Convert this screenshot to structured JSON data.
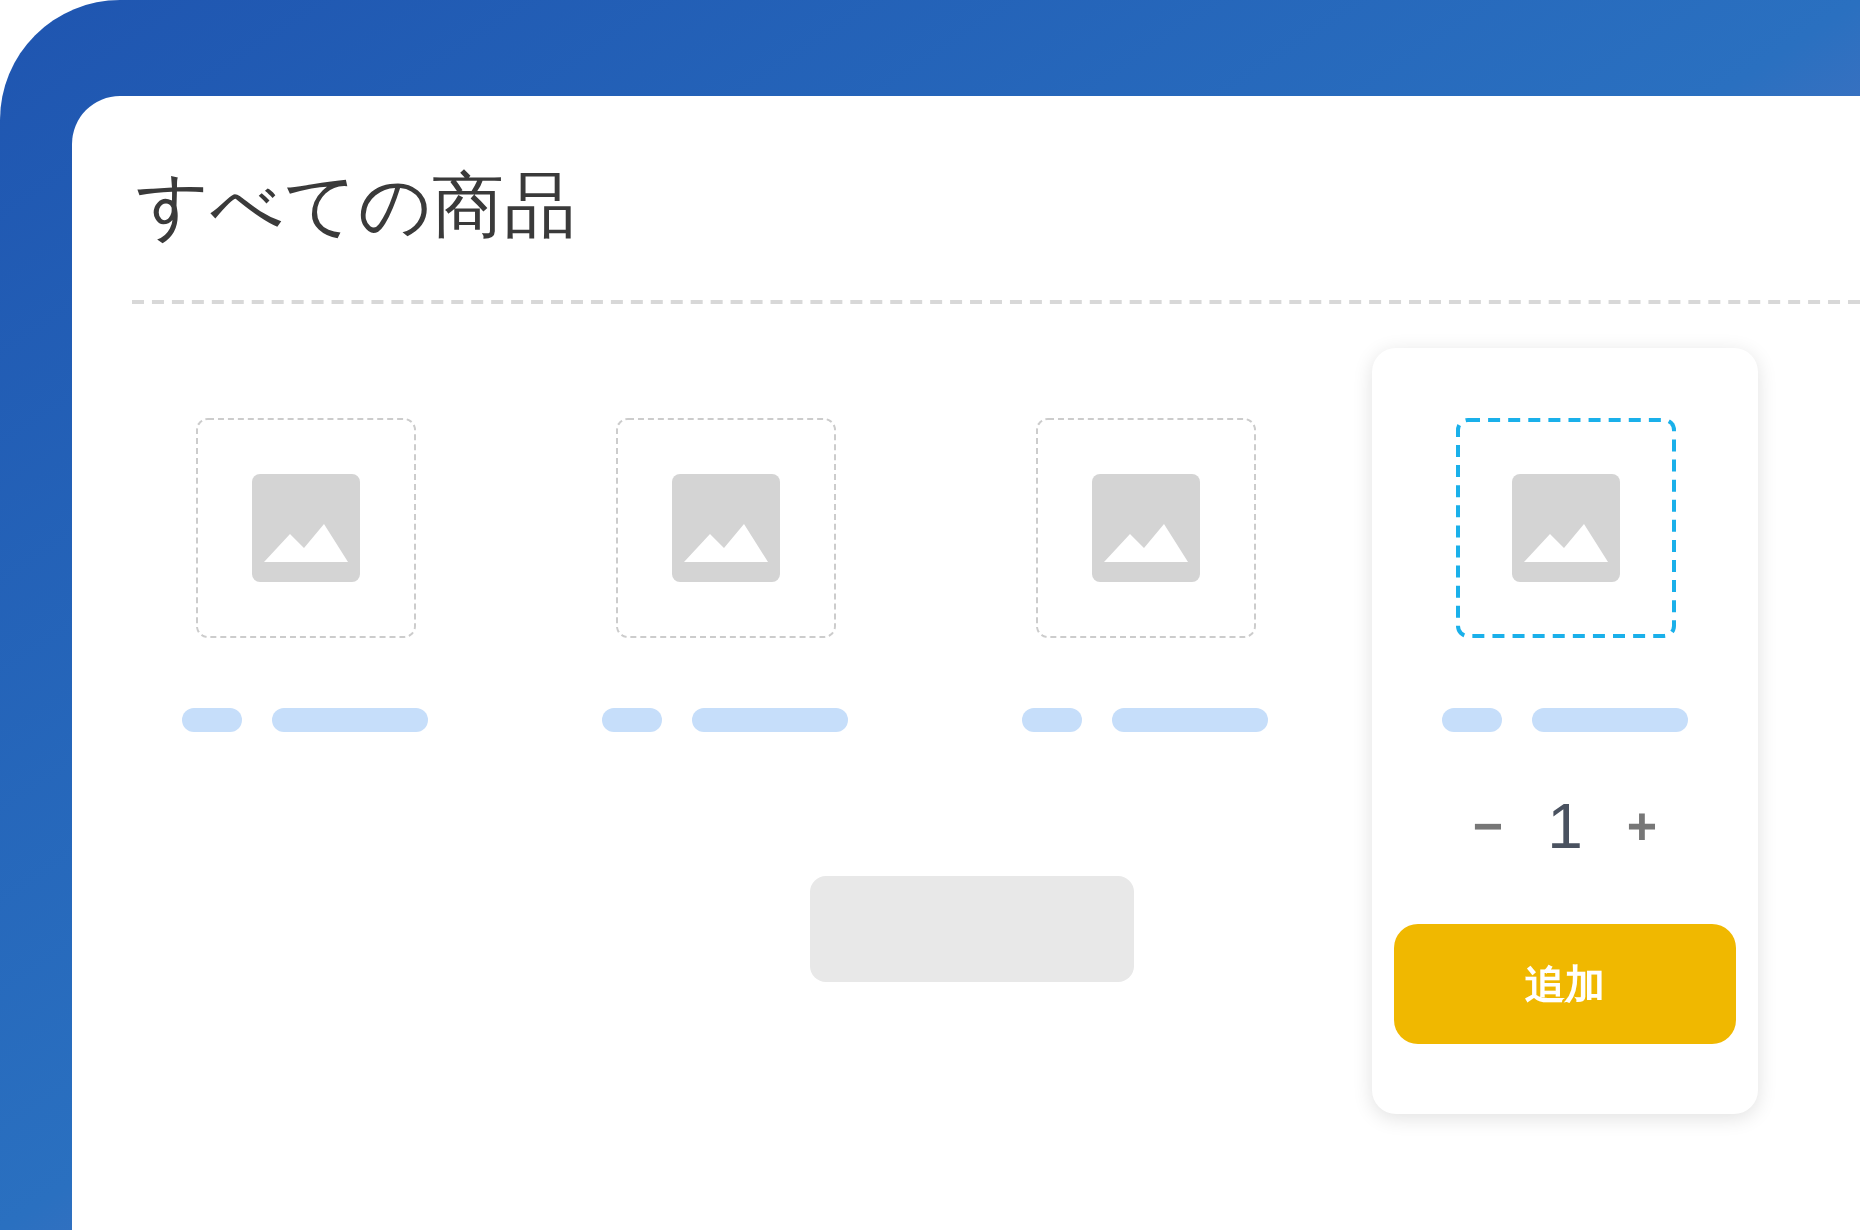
{
  "title": "すべての商品",
  "products": [
    {
      "selected": false
    },
    {
      "selected": false
    },
    {
      "selected": false
    },
    {
      "selected": true
    }
  ],
  "quantity_control": {
    "minus": "−",
    "quantity": "1",
    "plus": "+"
  },
  "add_button": "追加"
}
